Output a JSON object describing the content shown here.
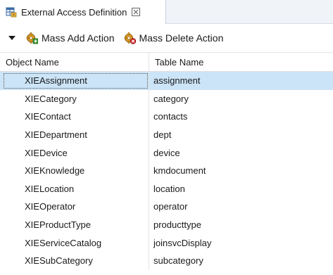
{
  "tab": {
    "title": "External Access Definition",
    "close_symbol": "☒",
    "icon": "table-editor-icon"
  },
  "toolbar": {
    "dropdown_icon": "triangle-down-icon",
    "mass_add_label": "Mass Add Action",
    "mass_add_icon": "gear-add-icon",
    "mass_delete_label": "Mass Delete Action",
    "mass_delete_icon": "gear-delete-icon"
  },
  "table": {
    "columns": [
      "Object Name",
      "Table Name"
    ],
    "rows": [
      {
        "object": "XIEAssignment",
        "table": "assignment",
        "selected": true
      },
      {
        "object": "XIECategory",
        "table": "category",
        "selected": false
      },
      {
        "object": "XIEContact",
        "table": "contacts",
        "selected": false
      },
      {
        "object": "XIEDepartment",
        "table": "dept",
        "selected": false
      },
      {
        "object": "XIEDevice",
        "table": "device",
        "selected": false
      },
      {
        "object": "XIEKnowledge",
        "table": "kmdocument",
        "selected": false
      },
      {
        "object": "XIELocation",
        "table": "location",
        "selected": false
      },
      {
        "object": "XIEOperator",
        "table": "operator",
        "selected": false
      },
      {
        "object": "XIEProductType",
        "table": "producttype",
        "selected": false
      },
      {
        "object": "XIEServiceCatalog",
        "table": "joinsvcDisplay",
        "selected": false
      },
      {
        "object": "XIESubCategory",
        "table": "subcategory",
        "selected": false
      }
    ]
  },
  "colors": {
    "selected_row": "#cce4f7",
    "tab_strip": "#f0f4f9",
    "accent": "#2a6ebb"
  }
}
